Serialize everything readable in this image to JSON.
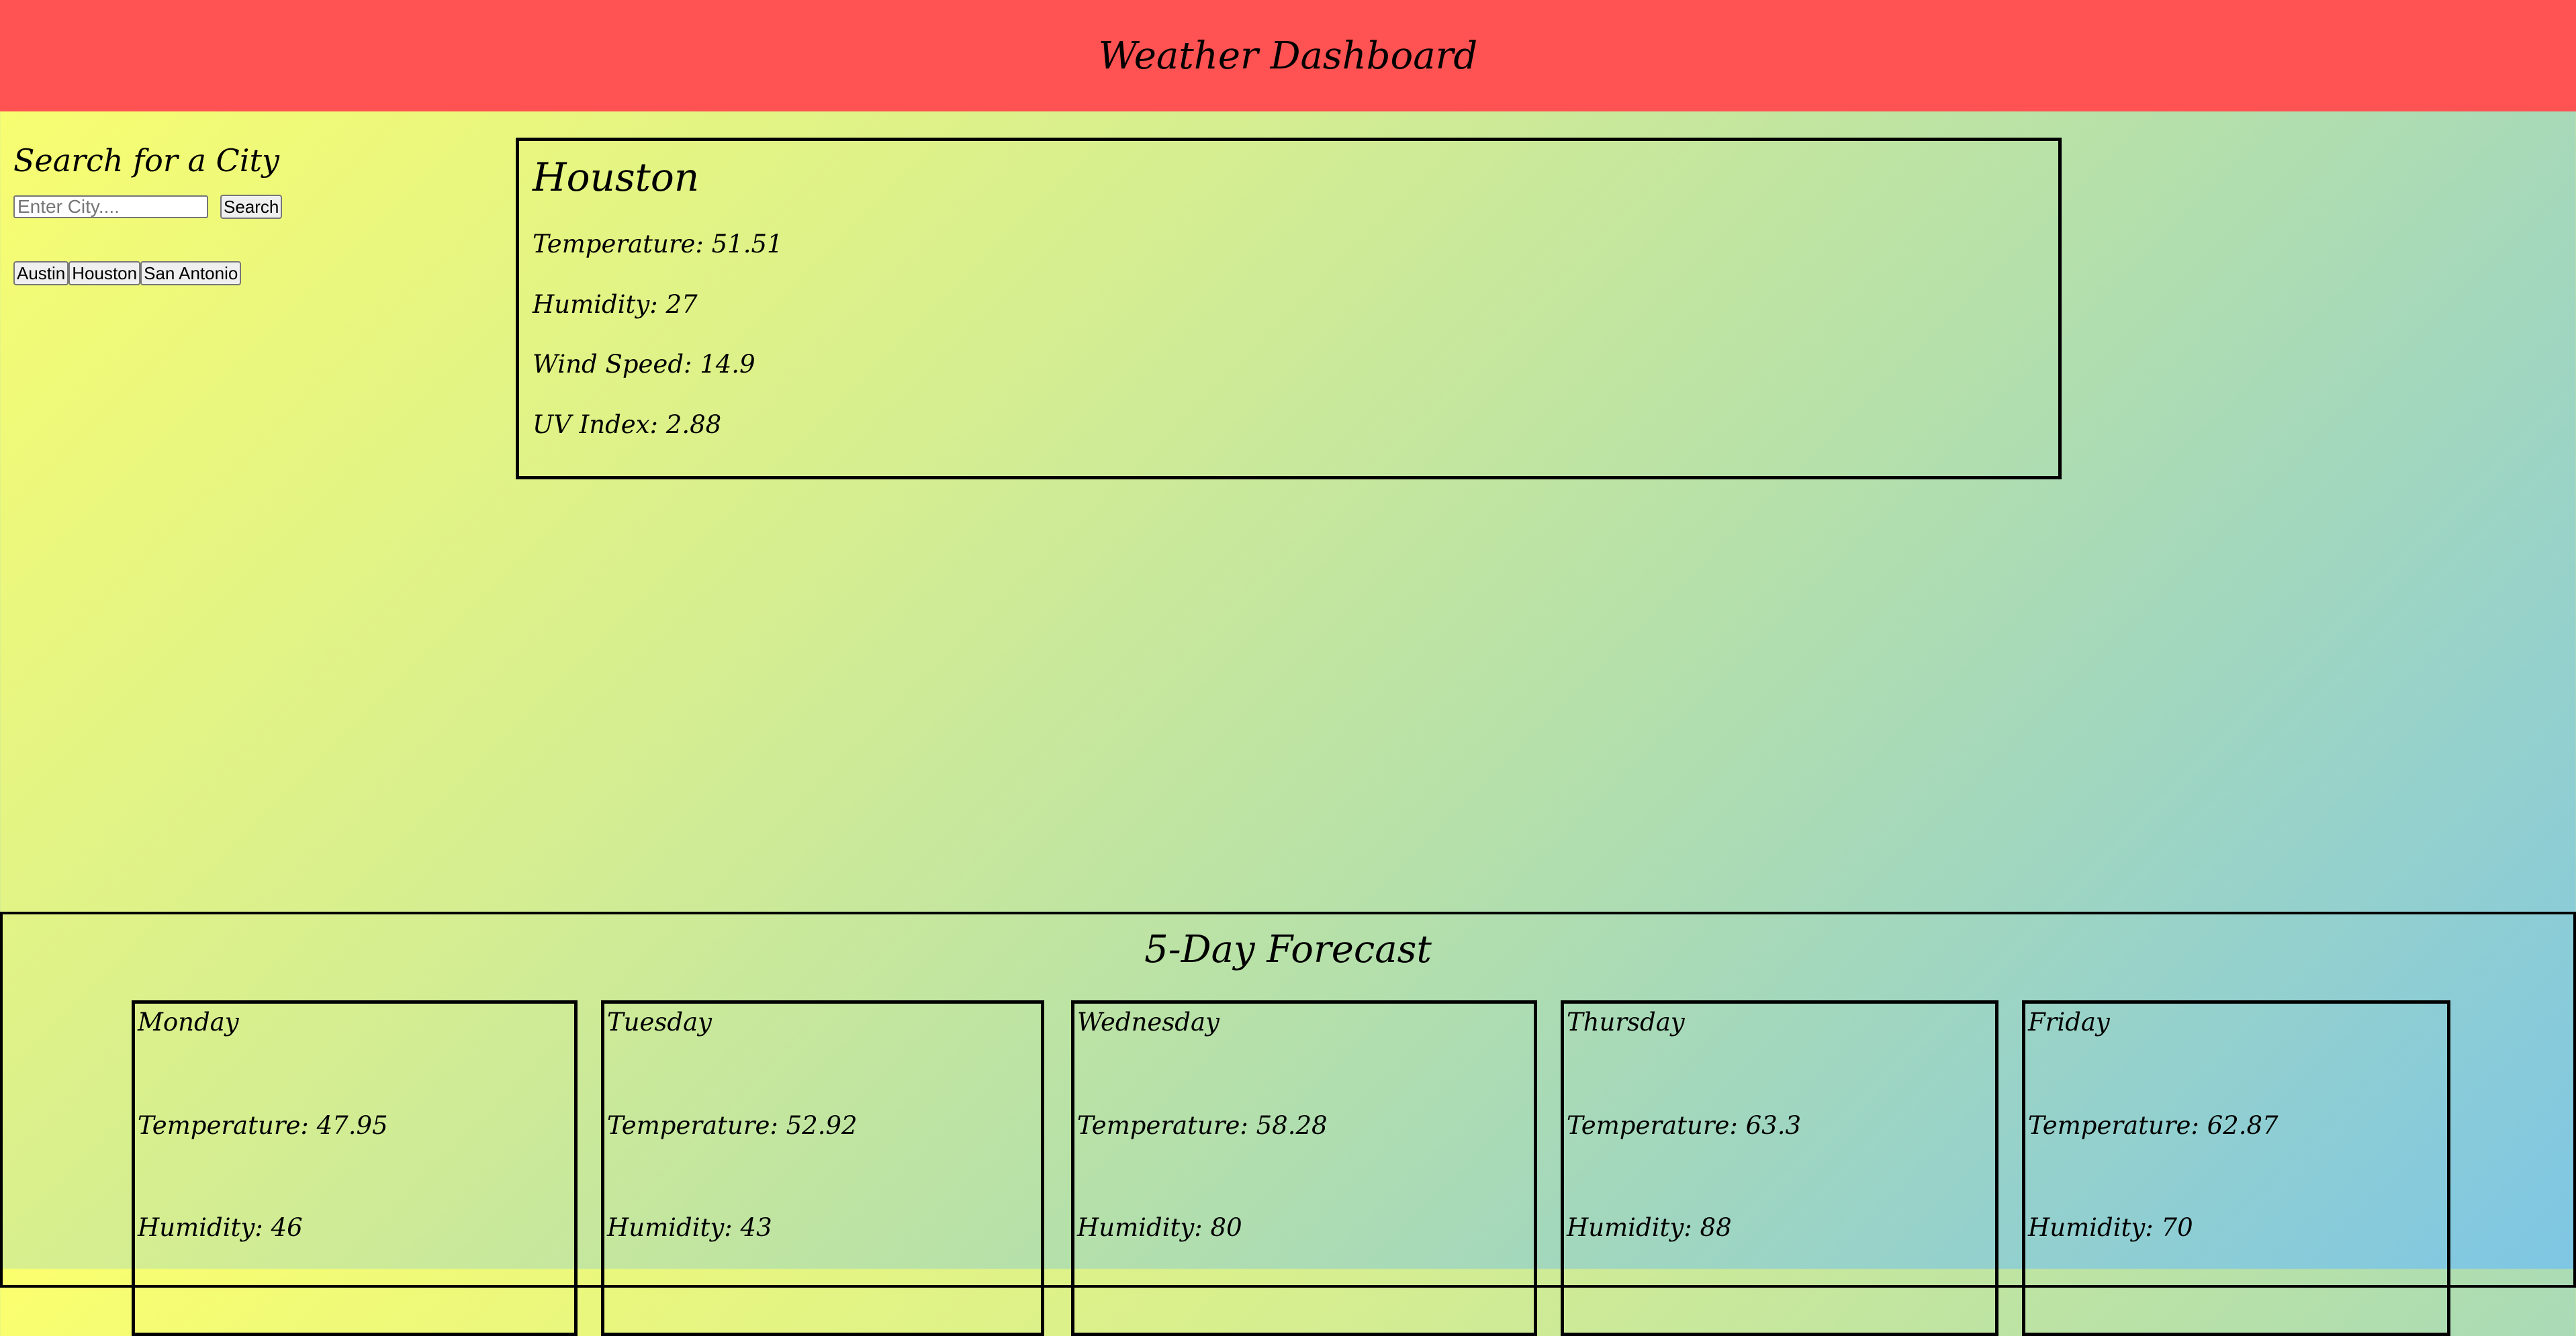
{
  "header": {
    "title": "Weather Dashboard",
    "background": "#ff5252"
  },
  "search": {
    "title": "Search for a City",
    "placeholder": "Enter City....",
    "button_label": "Search",
    "history": [
      "Austin",
      "Houston",
      "San Antonio"
    ]
  },
  "current": {
    "city": "Houston",
    "temperature": "Temperature: 51.51",
    "humidity": "Humidity: 27",
    "wind_speed": "Wind Speed: 14.9",
    "uv_index": "UV Index: 2.88"
  },
  "forecast": {
    "title": "5-Day Forecast",
    "days": [
      {
        "day": "Monday",
        "temperature": "Temperature: 47.95",
        "humidity": "Humidity: 46"
      },
      {
        "day": "Tuesday",
        "temperature": "Temperature: 52.92",
        "humidity": "Humidity: 43"
      },
      {
        "day": "Wednesday",
        "temperature": "Temperature: 58.28",
        "humidity": "Humidity: 80"
      },
      {
        "day": "Thursday",
        "temperature": "Temperature: 63.3",
        "humidity": "Humidity: 88"
      },
      {
        "day": "Friday",
        "temperature": "Temperature: 62.87",
        "humidity": "Humidity: 70"
      }
    ]
  }
}
